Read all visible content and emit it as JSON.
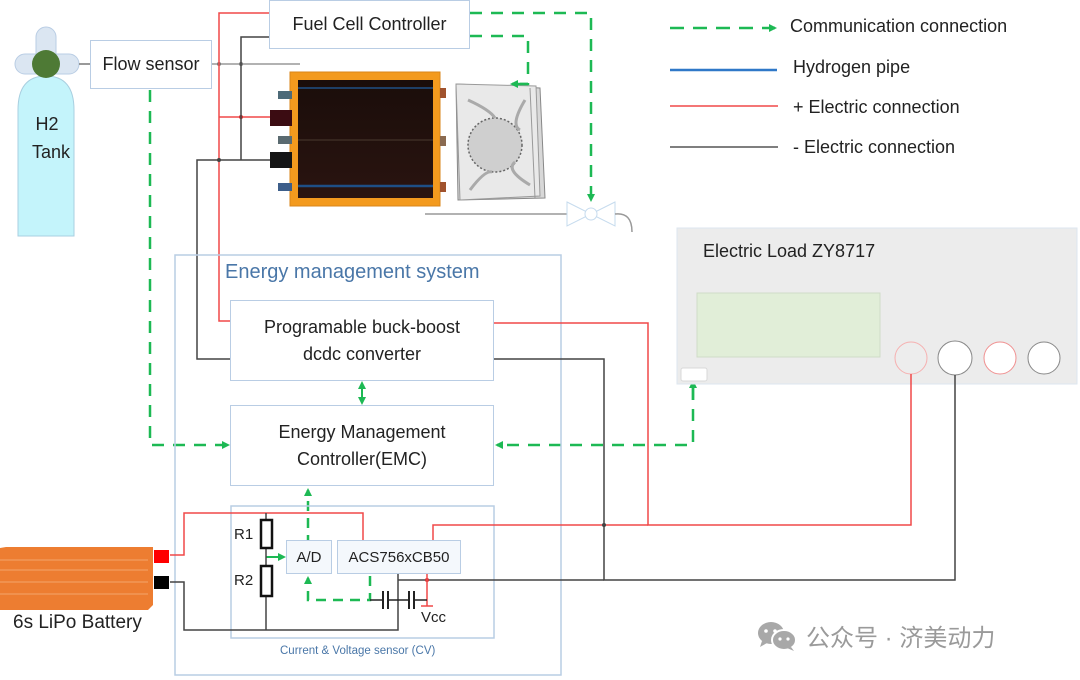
{
  "legend": {
    "items": [
      {
        "label": "Communication connection",
        "style": "dashed-arrow",
        "color": "#1db954"
      },
      {
        "label": "Hydrogen pipe",
        "style": "solid",
        "color": "#2f78c8"
      },
      {
        "label": "+ Electric connection",
        "style": "solid",
        "color": "#f04848"
      },
      {
        "label": "-  Electric connection",
        "style": "solid",
        "color": "#555555"
      }
    ]
  },
  "components": {
    "h2_tank": {
      "line1": "H2",
      "line2": "Tank"
    },
    "flow_sensor": "Flow sensor",
    "fuel_cell_controller": "Fuel Cell Controller",
    "electric_load": "Electric Load ZY8717",
    "ems": {
      "title": "Energy management system",
      "dcdc": {
        "line1": "Programable buck-boost",
        "line2": "dcdc converter"
      },
      "emc": {
        "line1": "Energy Management",
        "line2": "Controller(EMC)"
      },
      "cv": {
        "title": "Current & Voltage sensor (CV)",
        "r1": "R1",
        "r2": "R2",
        "ad": "A/D",
        "current_sensor": "ACS756xCB50",
        "vcc": "Vcc"
      }
    },
    "battery": "6s LiPo Battery"
  },
  "colors": {
    "communication": "#1db954",
    "hydrogen": "#2f78c8",
    "positive": "#f04848",
    "negative": "#555555",
    "box_border": "#b9cde4",
    "ems_title": "#4a77a8",
    "load_panel": "#ececec",
    "load_display": "#e1eed8",
    "battery": "#ed7d31",
    "tank": "#c4f4fb",
    "tank_valve": "#4e7a35"
  },
  "watermark": {
    "text": "公众号 · 济美动力",
    "icon": "wechat-icon"
  }
}
